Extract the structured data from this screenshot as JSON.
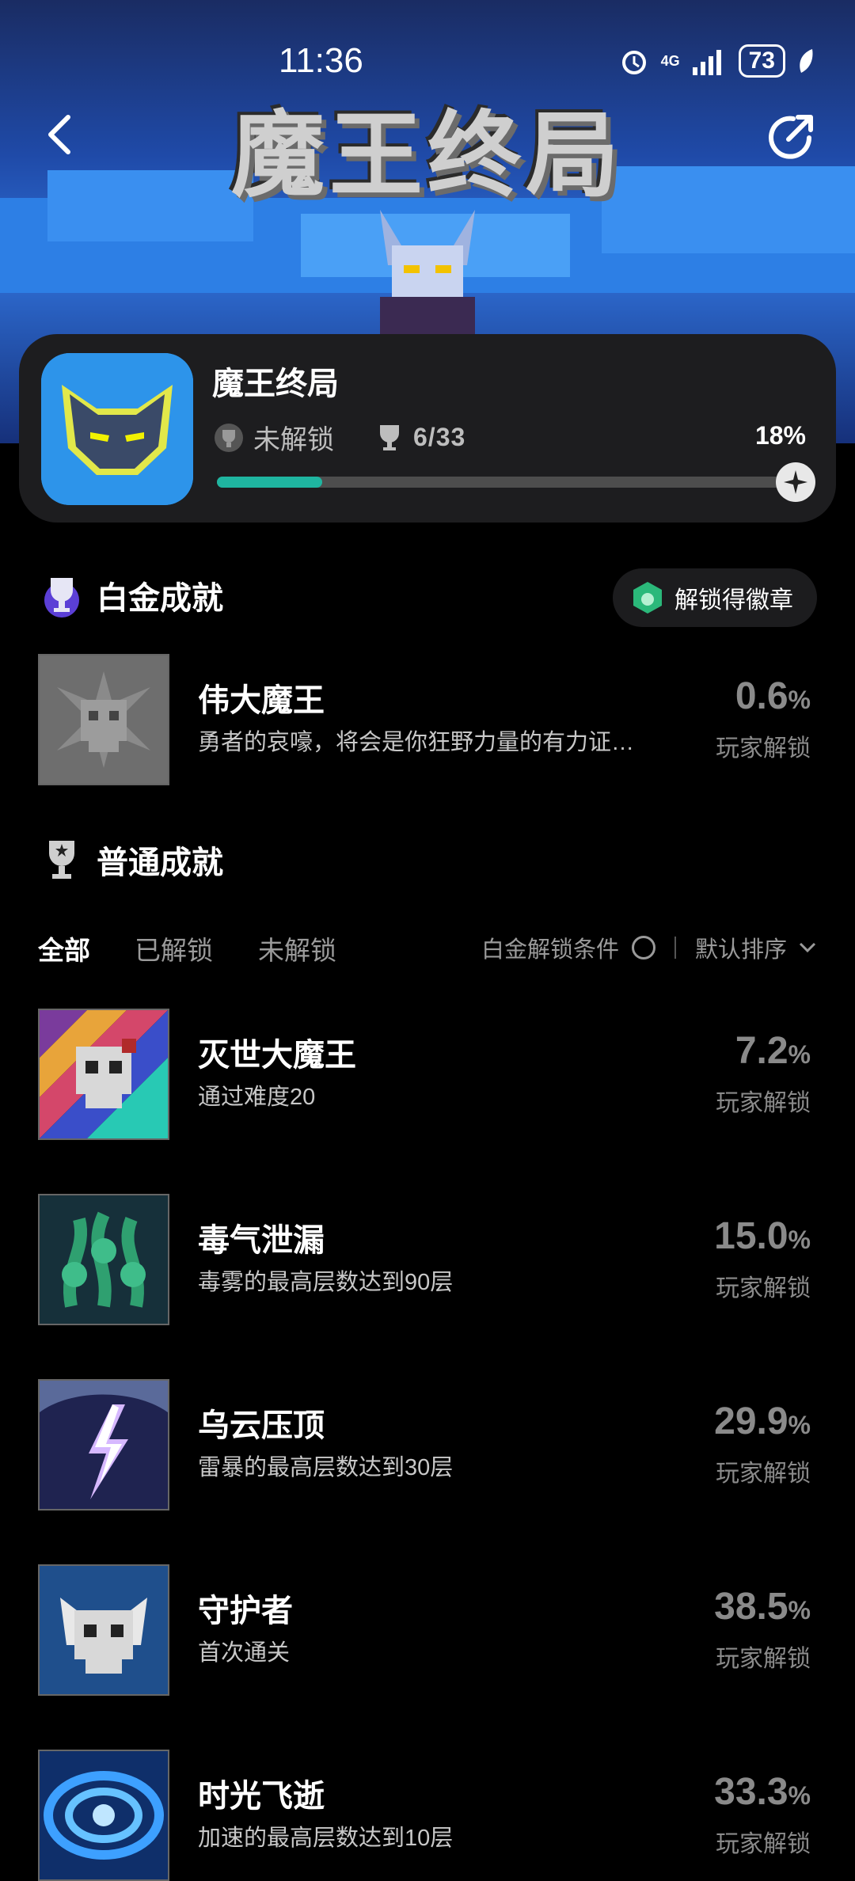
{
  "status_bar": {
    "time": "11:36",
    "network": "4G",
    "battery": "73"
  },
  "hero": {
    "title": "魔王终局"
  },
  "game": {
    "title": "魔王终局",
    "lock_status": "未解锁",
    "trophy_count": "6/33",
    "percent": "18%",
    "progress_fraction": 0.18
  },
  "platinum": {
    "section_title": "白金成就",
    "badge_button": "解锁得徽章",
    "achievement": {
      "name": "伟大魔王",
      "desc": "勇者的哀嚎，将会是你狂野力量的有力证…",
      "pct_value": "0.6",
      "pct_unit": "%",
      "pct_label": "玩家解锁"
    }
  },
  "normal": {
    "section_title": "普通成就",
    "tabs": [
      "全部",
      "已解锁",
      "未解锁"
    ],
    "filter_condition": "白金解锁条件",
    "sort": "默认排序",
    "achievements": [
      {
        "name": "灭世大魔王",
        "desc": "通过难度20",
        "pct_value": "7.2",
        "pct_unit": "%",
        "pct_label": "玩家解锁",
        "icon": "skull-icon",
        "color": "#e85a4f"
      },
      {
        "name": "毒气泄漏",
        "desc": "毒雾的最高层数达到90层",
        "pct_value": "15.0",
        "pct_unit": "%",
        "pct_label": "玩家解锁",
        "icon": "poison-icon",
        "color": "#1f6d5a"
      },
      {
        "name": "乌云压顶",
        "desc": "雷暴的最高层数达到30层",
        "pct_value": "29.9",
        "pct_unit": "%",
        "pct_label": "玩家解锁",
        "icon": "lightning-icon",
        "color": "#3d3a7a"
      },
      {
        "name": "守护者",
        "desc": "首次通关",
        "pct_value": "38.5",
        "pct_unit": "%",
        "pct_label": "玩家解锁",
        "icon": "skull-icon",
        "color": "#1f4f8c"
      },
      {
        "name": "时光飞逝",
        "desc": "加速的最高层数达到10层",
        "pct_value": "33.3",
        "pct_unit": "%",
        "pct_label": "玩家解锁",
        "icon": "vortex-icon",
        "color": "#1f6fc9"
      }
    ]
  }
}
